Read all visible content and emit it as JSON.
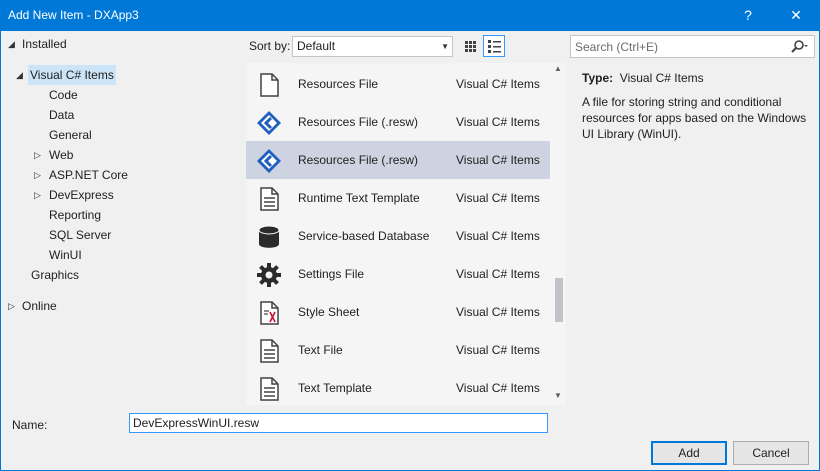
{
  "window": {
    "title": "Add New Item - DXApp3",
    "help_glyph": "?",
    "close_glyph": "✕",
    "accent": "#0078d7"
  },
  "tree": {
    "installed": "Installed",
    "visual_cs_items": "Visual C# Items",
    "children": [
      "Code",
      "Data",
      "General",
      "Web",
      "ASP.NET Core",
      "DevExpress",
      "Reporting",
      "SQL Server",
      "WinUI"
    ],
    "graphics": "Graphics",
    "online": "Online"
  },
  "toolbar": {
    "sort_label": "Sort by:",
    "sort_value": "Default",
    "search_placeholder": "Search (Ctrl+E)"
  },
  "items": [
    {
      "name": "Resources File",
      "type": "Visual C# Items",
      "icon": "file-icon"
    },
    {
      "name": "Resources File (.resw)",
      "type": "Visual C# Items",
      "icon": "resw-icon"
    },
    {
      "name": "Resources File (.resw)",
      "type": "Visual C# Items",
      "icon": "resw-icon",
      "selected": true
    },
    {
      "name": "Runtime Text Template",
      "type": "Visual C# Items",
      "icon": "text-template-icon"
    },
    {
      "name": "Service-based Database",
      "type": "Visual C# Items",
      "icon": "database-icon"
    },
    {
      "name": "Settings File",
      "type": "Visual C# Items",
      "icon": "gear-icon"
    },
    {
      "name": "Style Sheet",
      "type": "Visual C# Items",
      "icon": "style-sheet-icon"
    },
    {
      "name": "Text File",
      "type": "Visual C# Items",
      "icon": "text-file-icon"
    },
    {
      "name": "Text Template",
      "type": "Visual C# Items",
      "icon": "text-template-icon"
    }
  ],
  "details": {
    "type_label": "Type:",
    "type_value": "Visual C# Items",
    "description": "A file for storing string and conditional resources for apps based on the Windows UI Library (WinUI)."
  },
  "footer": {
    "name_label": "Name:",
    "name_value": "DevExpressWinUI.resw",
    "add_label": "Add",
    "cancel_label": "Cancel"
  }
}
